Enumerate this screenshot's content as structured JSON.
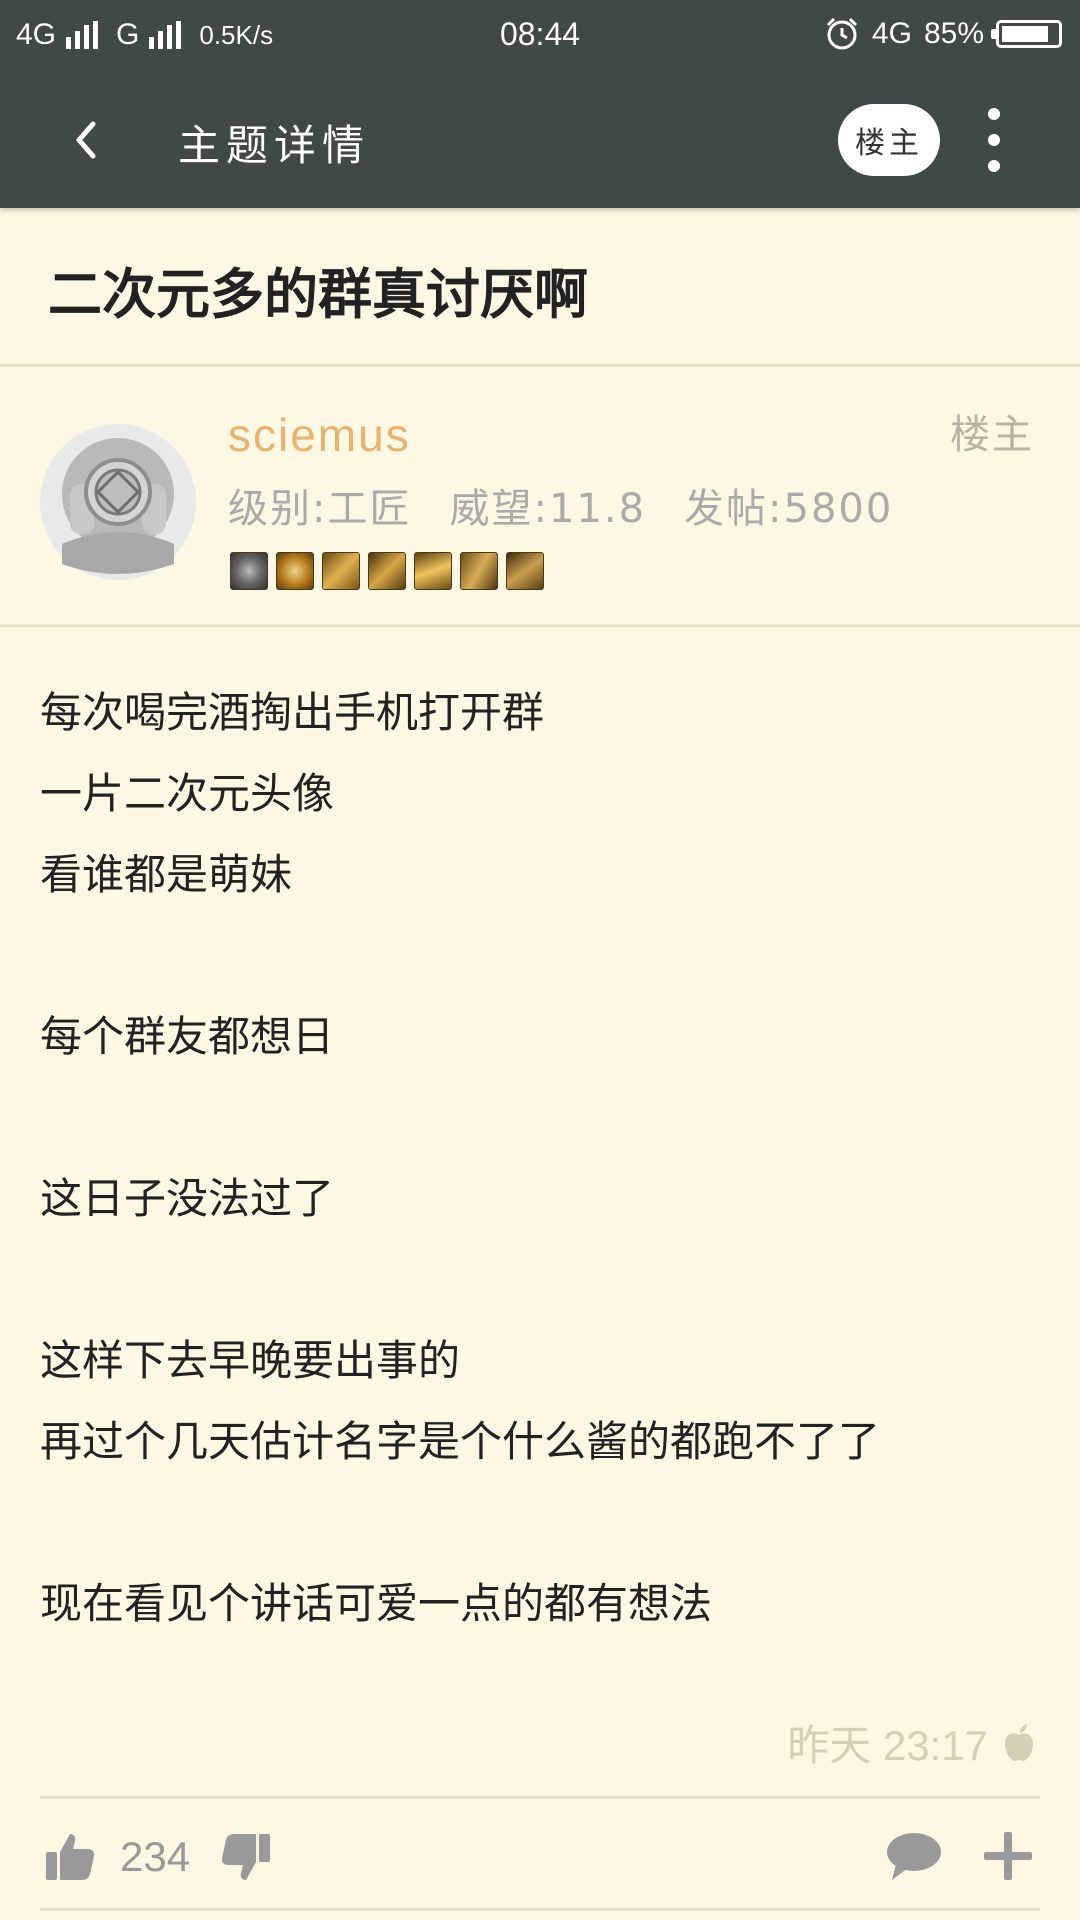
{
  "status_bar": {
    "network1": "4G",
    "network2": "G",
    "speed": "0.5K/s",
    "time": "08:44",
    "network3": "4G",
    "battery": "85%",
    "battery_level": 0.85
  },
  "app_bar": {
    "back_icon": "chevron-left-icon",
    "title": "主题详情",
    "op_button": "楼主",
    "more_icon": "more-vertical-icon"
  },
  "thread": {
    "title": "二次元多的群真讨厌啊"
  },
  "author": {
    "name": "sciemus",
    "level": "级别:工匠",
    "prestige": "威望:11.8",
    "posts": "发帖:5800",
    "op_tag": "楼主",
    "avatar_icon": "diving-helmet-icon",
    "medals": [
      "medal-1-icon",
      "medal-2-icon",
      "medal-3-icon",
      "medal-4-icon",
      "medal-5-icon",
      "medal-6-icon",
      "medal-7-icon"
    ]
  },
  "post": {
    "lines": [
      "每次喝完酒掏出手机打开群",
      "一片二次元头像",
      "看谁都是萌妹",
      "",
      "每个群友都想日",
      "",
      "这日子没法过了",
      "",
      "这样下去早晚要出事的",
      "再过个几天估计名字是个什么酱的都跑不了了",
      "",
      "现在看见个讲话可爱一点的都有想法"
    ],
    "time": "昨天 23:17",
    "device_icon": "apple-icon"
  },
  "actions": {
    "likes": "234",
    "like_icon": "thumbs-up-icon",
    "dislike_icon": "thumbs-down-icon",
    "comment_icon": "comment-icon",
    "add_icon": "plus-icon"
  },
  "colors": {
    "bar_bg": "#3f4a48",
    "page_bg": "#fdf8e4",
    "author_name": "#e8b371"
  }
}
